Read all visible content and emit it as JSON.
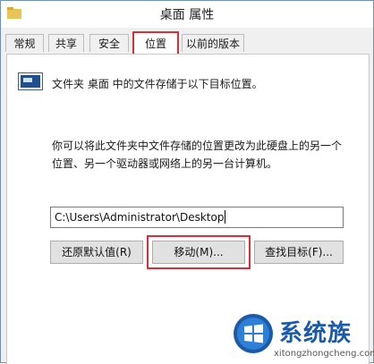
{
  "window": {
    "title": "桌面 属性"
  },
  "tabs": [
    {
      "label": "常规"
    },
    {
      "label": "共享"
    },
    {
      "label": "安全"
    },
    {
      "label": "位置"
    },
    {
      "label": "以前的版本"
    }
  ],
  "location": {
    "description": "文件夹 桌面 中的文件存储于以下目标位置。",
    "help_text": "你可以将此文件夹中文件存储的位置更改为此硬盘上的另一个位置、另一个驱动器或网络上的另一台计算机。",
    "path_value": "C:\\Users\\Administrator\\Desktop",
    "restore_label": "还原默认值(R)",
    "move_label": "移动(M)...",
    "find_target_label": "查找目标(F)..."
  },
  "watermark": {
    "brand": "系统族",
    "url": "xitongzhongcheng.com"
  },
  "colors": {
    "highlight": "#d7303a",
    "brand_blue": "#1b5aa8"
  }
}
